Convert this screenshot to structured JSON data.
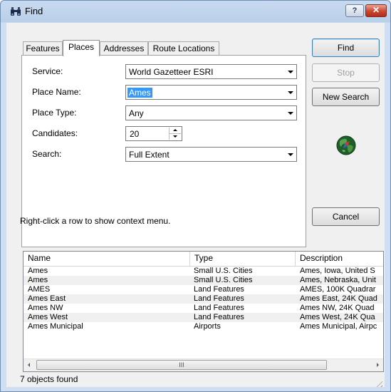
{
  "window": {
    "title": "Find",
    "help_label": "?",
    "close_label": "✕",
    "icon": "binoculars-icon"
  },
  "tabs": [
    {
      "label": "Features"
    },
    {
      "label": "Places"
    },
    {
      "label": "Addresses"
    },
    {
      "label": "Route Locations"
    }
  ],
  "active_tab": "Places",
  "form": {
    "service_label": "Service:",
    "service_value": "World Gazetteer ESRI",
    "place_name_label": "Place Name:",
    "place_name_value": "Ames",
    "place_type_label": "Place Type:",
    "place_type_value": "Any",
    "candidates_label": "Candidates:",
    "candidates_value": "20",
    "search_label": "Search:",
    "search_value": "Full Extent"
  },
  "buttons": {
    "find": "Find",
    "stop": "Stop",
    "new_search": "New Search",
    "cancel": "Cancel"
  },
  "hint": "Right-click a row to show context menu.",
  "results": {
    "columns": [
      "Name",
      "Type",
      "Description"
    ],
    "rows": [
      [
        "Ames",
        "Small U.S. Cities",
        "Ames, Iowa, United S"
      ],
      [
        "Ames",
        "Small U.S. Cities",
        "Ames, Nebraska, Unit"
      ],
      [
        "AMES",
        "Land Features",
        "AMES, 100K Quadrar"
      ],
      [
        "Ames East",
        "Land Features",
        "Ames East, 24K Quad"
      ],
      [
        "Ames NW",
        "Land Features",
        "Ames NW, 24K Quad"
      ],
      [
        "Ames West",
        "Land Features",
        "Ames West, 24K Qua"
      ],
      [
        "Ames Municipal",
        "Airports",
        "Ames Municipal, Airpc"
      ]
    ],
    "scroll_thumb_label": "III"
  },
  "status": "7 objects found"
}
